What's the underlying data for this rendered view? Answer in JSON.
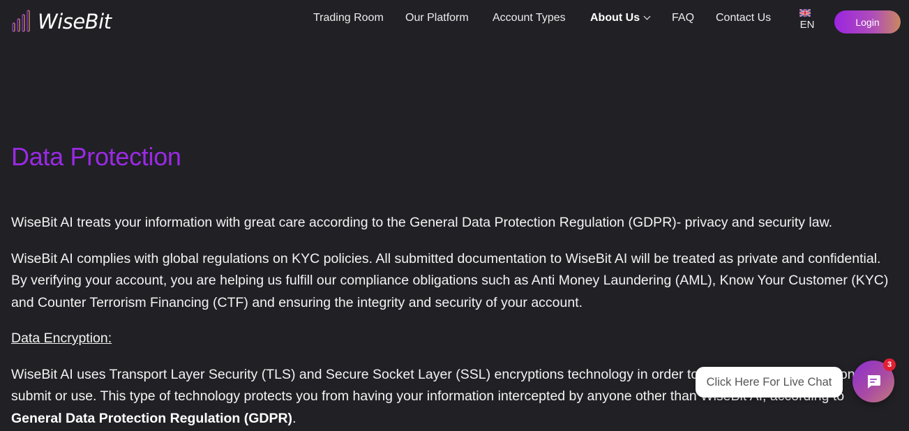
{
  "brand": {
    "name": "WiseBit"
  },
  "nav": {
    "items": [
      {
        "label": "Trading Room"
      },
      {
        "label": "Our Platform"
      },
      {
        "label": "Account Types"
      },
      {
        "label": "About Us"
      },
      {
        "label": "FAQ"
      },
      {
        "label": "Contact Us"
      }
    ],
    "active": "About Us",
    "language": "EN",
    "language_icon": "uk-flag-icon",
    "login_label": "Login"
  },
  "main": {
    "title": "Data Protection",
    "paragraphs": [
      "WiseBit AI treats your information with great care according to the General Data Protection Regulation (GDPR)- privacy and security law.",
      "WiseBit AI complies with global regulations on KYC policies. All submitted documentation to WiseBit AI will be treated as private and confidential. By verifying your account, you are helping us fulfill our compliance obligations such as Anti Money Laundering (AML), Know Your Customer (KYC) and Counter Terrorism Financing (CTF) and ensuring the integrity and security of your account."
    ],
    "section_heading": "Data Encryption:",
    "encryption_text": "WiseBit AI uses Transport Layer Security (TLS) and Secure Socket Layer (SSL) encryptions technology in order to protect all the information you submit or use. This type of technology protects you from having your information intercepted by anyone other than WiseBit AI, according to",
    "encryption_bold": "General Data Protection Regulation (GDPR)",
    "encryption_end": "."
  },
  "chat": {
    "prompt": "Click Here For Live Chat",
    "badge_count": "3",
    "icon": "chat-icon"
  },
  "colors": {
    "background": "#212025",
    "title": "#9a2ae6",
    "accent_gradient_start": "#9b24e0",
    "accent_gradient_end": "#c9885e",
    "badge": "#e21f35"
  }
}
